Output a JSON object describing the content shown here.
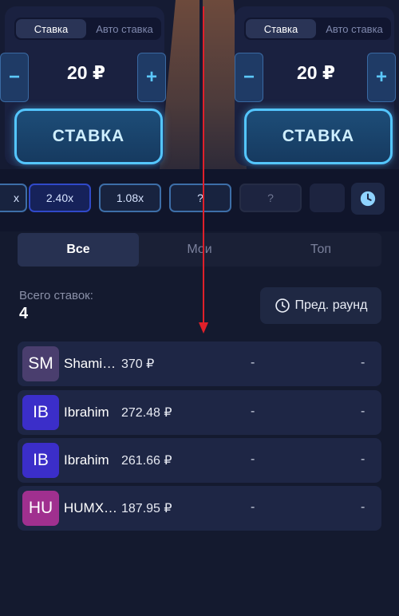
{
  "panels": [
    {
      "mode_tabs": [
        "Ставка",
        "Авто ставка"
      ],
      "minus": "−",
      "plus": "+",
      "amount": "20 ₽",
      "bet_label": "СТАВКА"
    },
    {
      "mode_tabs": [
        "Ставка",
        "Авто ставка"
      ],
      "minus": "−",
      "plus": "+",
      "amount": "20 ₽",
      "bet_label": "СТАВКА"
    }
  ],
  "multipliers": [
    "x",
    "2.40x",
    "1.08x",
    "?",
    "?"
  ],
  "tabs": [
    "Все",
    "Мои",
    "Топ"
  ],
  "totals": {
    "label": "Всего ставок:",
    "value": "4"
  },
  "prev_round": "Пред. раунд",
  "bets": [
    {
      "initials": "SM",
      "name": "Shami…",
      "amount": "370 ₽",
      "multiplier": "-",
      "win": "-",
      "avatar_color": "#4a3e6e"
    },
    {
      "initials": "IB",
      "name": "Ibrahim",
      "amount": "272.48 ₽",
      "multiplier": "-",
      "win": "-",
      "avatar_color": "#3b2ec9"
    },
    {
      "initials": "IB",
      "name": "Ibrahim",
      "amount": "261.66 ₽",
      "multiplier": "-",
      "win": "-",
      "avatar_color": "#3b2ec9"
    },
    {
      "initials": "HU",
      "name": "HUMX…",
      "amount": "187.95 ₽",
      "multiplier": "-",
      "win": "-",
      "avatar_color": "#a0308f"
    }
  ],
  "colors": {
    "accent": "#54c6ff",
    "background": "#141a2f",
    "arrow": "#e0202a"
  }
}
